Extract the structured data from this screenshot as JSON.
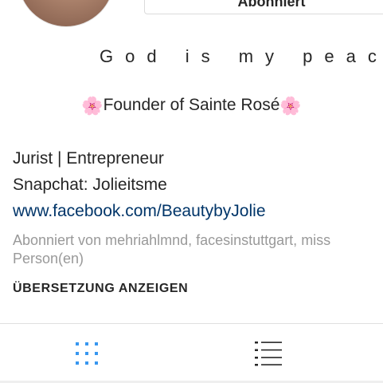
{
  "profile": {
    "follow_button_label": "Abonniert",
    "tagline": "God is my peac",
    "founder": {
      "prefix_emoji": "🌸",
      "text": "Founder of Sainte Rosé",
      "suffix_emoji": "🌸"
    },
    "bio_line_1": "Jurist | Entrepreneur",
    "bio_line_2": "Snapchat: Jolieitsme",
    "website": "www.facebook.com/BeautybyJolie",
    "followed_by_line_1": "Abonniert von mehriahlmnd, facesinstuttgart, miss",
    "followed_by_line_2": "Person(en)",
    "translate_label": "ÜBERSETZUNG ANZEIGEN"
  },
  "tabs": [
    {
      "icon": "grid-icon",
      "active": true,
      "color": "#3897f0"
    },
    {
      "icon": "list-icon",
      "active": false,
      "color": "#262626"
    }
  ],
  "colors": {
    "link": "#003569",
    "muted": "#999999",
    "text": "#262626",
    "accent": "#3897f0"
  }
}
